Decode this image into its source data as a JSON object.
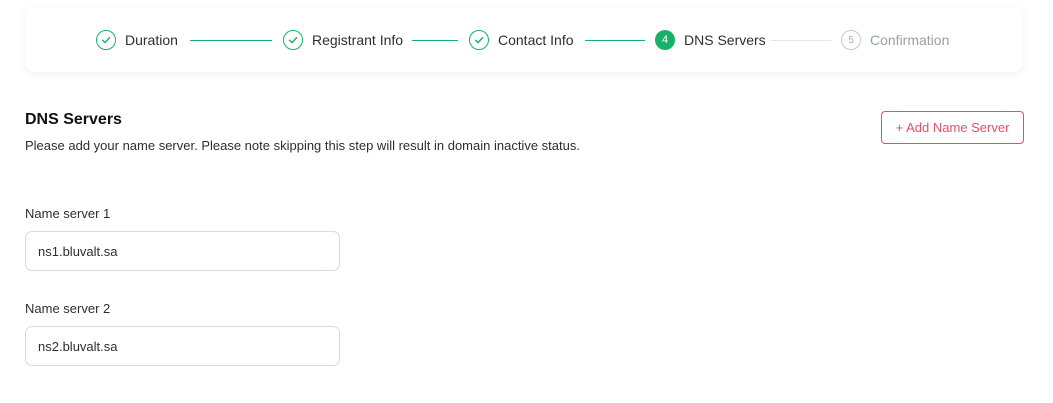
{
  "stepper": {
    "steps": [
      {
        "label": "Duration",
        "status": "done"
      },
      {
        "label": "Registrant Info",
        "status": "done"
      },
      {
        "label": "Contact Info",
        "status": "done"
      },
      {
        "label": "DNS Servers",
        "status": "active",
        "number": "4"
      },
      {
        "label": "Confirmation",
        "status": "pending",
        "number": "5"
      }
    ],
    "done_icon": "check-circle-icon",
    "accent_color": "#17b26a",
    "pending_color": "#c4c7cc"
  },
  "section": {
    "title": "DNS Servers",
    "description": "Please add your name server. Please note skipping this step will result in domain inactive status."
  },
  "add_button": {
    "label": "+ Add Name Server",
    "color": "#e0516b"
  },
  "name_servers": [
    {
      "label": "Name server 1",
      "value": "ns1.bluvalt.sa"
    },
    {
      "label": "Name server 2",
      "value": "ns2.bluvalt.sa"
    }
  ]
}
